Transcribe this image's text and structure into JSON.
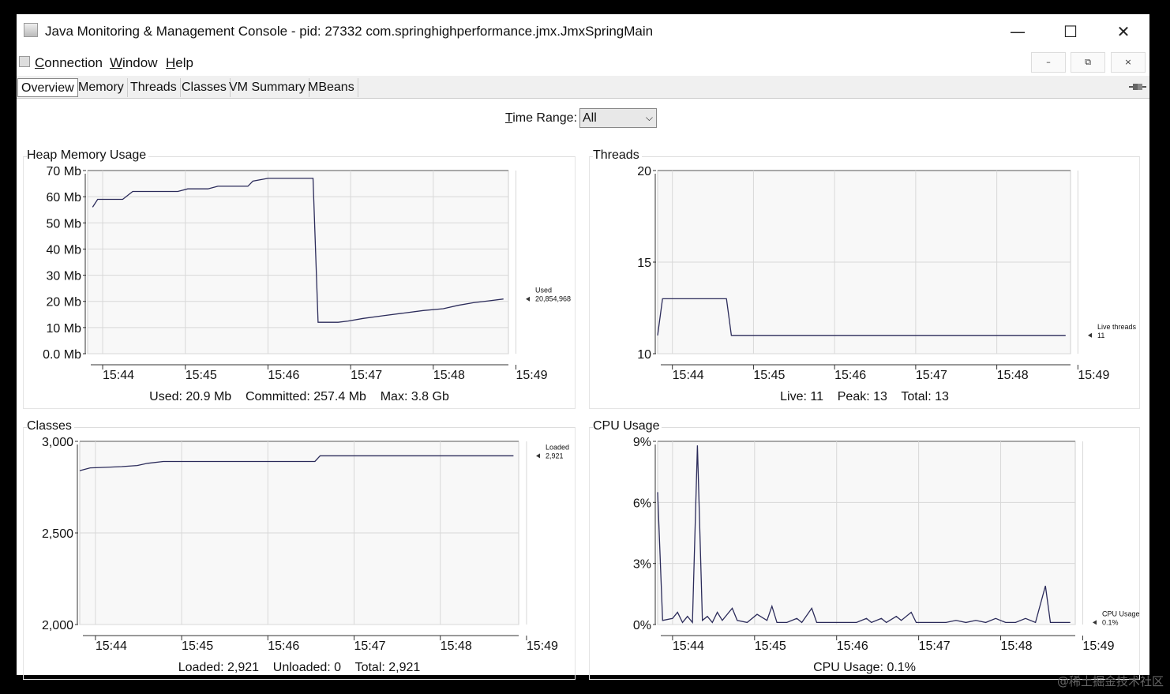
{
  "window": {
    "title": "Java Monitoring & Management Console - pid: 27332 com.springhighperformance.jmx.JmxSpringMain",
    "minimize": "—",
    "maximize": "☐",
    "close": "✕"
  },
  "menu": {
    "connection": "onnection",
    "connection_key": "C",
    "window": "indow",
    "window_key": "W",
    "help": "elp",
    "help_key": "H",
    "mdi_min": "–",
    "mdi_restore": "⧉",
    "mdi_close": "×"
  },
  "tabs": [
    "Overview",
    "Memory",
    "Threads",
    "Classes",
    "VM Summary",
    "MBeans"
  ],
  "time_range": {
    "label_key": "T",
    "label_rest": "ime Range:",
    "value": "All"
  },
  "chart_data": [
    {
      "type": "line",
      "title": "Heap Memory Usage",
      "x_ticks": [
        "15:44",
        "15:45",
        "15:46",
        "15:47",
        "15:48",
        "15:49"
      ],
      "y_ticks": [
        "0.0 Mb",
        "10 Mb",
        "20 Mb",
        "30 Mb",
        "40 Mb",
        "50 Mb",
        "60 Mb",
        "70 Mb"
      ],
      "ylim": [
        0,
        70
      ],
      "xlim": [
        15.4,
        16.24
      ],
      "series": [
        {
          "name": "Used",
          "points": [
            [
              15.41,
              56
            ],
            [
              15.42,
              59
            ],
            [
              15.47,
              59
            ],
            [
              15.49,
              62
            ],
            [
              15.58,
              62
            ],
            [
              15.6,
              63
            ],
            [
              15.64,
              63
            ],
            [
              15.66,
              64
            ],
            [
              15.72,
              64
            ],
            [
              15.73,
              66
            ],
            [
              15.76,
              67
            ],
            [
              15.85,
              67
            ],
            [
              15.86,
              12
            ],
            [
              15.9,
              12
            ],
            [
              15.92,
              12.5
            ],
            [
              15.95,
              13.5
            ],
            [
              15.99,
              14.5
            ],
            [
              16.03,
              15.5
            ],
            [
              16.07,
              16.5
            ],
            [
              16.11,
              17.2
            ],
            [
              16.14,
              18.5
            ],
            [
              16.17,
              19.5
            ],
            [
              16.2,
              20.2
            ],
            [
              16.23,
              20.9
            ]
          ],
          "last_value": "20,854,968"
        }
      ],
      "summary": "Used: 20.9 Mb    Committed: 257.4 Mb    Max: 3.8 Gb"
    },
    {
      "type": "line",
      "title": "Threads",
      "x_ticks": [
        "15:44",
        "15:45",
        "15:46",
        "15:47",
        "15:48",
        "15:49"
      ],
      "y_ticks": [
        "10",
        "15",
        "20"
      ],
      "ylim": [
        10,
        20
      ],
      "xlim": [
        15.4,
        16.24
      ],
      "series": [
        {
          "name": "Live threads",
          "points": [
            [
              15.4,
              11
            ],
            [
              15.41,
              13
            ],
            [
              15.54,
              13
            ],
            [
              15.55,
              11
            ],
            [
              16.23,
              11
            ]
          ],
          "last_value": "11"
        }
      ],
      "summary": "Live: 11    Peak: 13    Total: 13"
    },
    {
      "type": "line",
      "title": "Classes",
      "x_ticks": [
        "15:44",
        "15:45",
        "15:46",
        "15:47",
        "15:48",
        "15:49"
      ],
      "y_ticks": [
        "2,000",
        "2,500",
        "3,000"
      ],
      "ylim": [
        2000,
        3000
      ],
      "xlim": [
        15.4,
        16.24
      ],
      "series": [
        {
          "name": "Loaded",
          "points": [
            [
              15.4,
              2840
            ],
            [
              15.42,
              2855
            ],
            [
              15.45,
              2858
            ],
            [
              15.48,
              2862
            ],
            [
              15.51,
              2868
            ],
            [
              15.53,
              2880
            ],
            [
              15.56,
              2890
            ],
            [
              15.85,
              2890
            ],
            [
              15.86,
              2921
            ],
            [
              16.23,
              2921
            ]
          ],
          "last_value": "2,921"
        }
      ],
      "summary": "Loaded: 2,921    Unloaded: 0    Total: 2,921"
    },
    {
      "type": "line",
      "title": "CPU Usage",
      "x_ticks": [
        "15:44",
        "15:45",
        "15:46",
        "15:47",
        "15:48",
        "15:49"
      ],
      "y_ticks": [
        "0%",
        "3%",
        "6%",
        "9%"
      ],
      "ylim": [
        0,
        9
      ],
      "xlim": [
        15.4,
        16.24
      ],
      "series": [
        {
          "name": "CPU Usage",
          "points": [
            [
              15.4,
              6.5
            ],
            [
              15.41,
              0.2
            ],
            [
              15.43,
              0.3
            ],
            [
              15.44,
              0.6
            ],
            [
              15.45,
              0.1
            ],
            [
              15.46,
              0.4
            ],
            [
              15.47,
              0.1
            ],
            [
              15.48,
              8.8
            ],
            [
              15.49,
              0.2
            ],
            [
              15.5,
              0.4
            ],
            [
              15.51,
              0.1
            ],
            [
              15.52,
              0.6
            ],
            [
              15.53,
              0.2
            ],
            [
              15.55,
              0.8
            ],
            [
              15.56,
              0.2
            ],
            [
              15.58,
              0.1
            ],
            [
              15.6,
              0.5
            ],
            [
              15.62,
              0.2
            ],
            [
              15.63,
              0.9
            ],
            [
              15.64,
              0.1
            ],
            [
              15.66,
              0.1
            ],
            [
              15.68,
              0.3
            ],
            [
              15.69,
              0.1
            ],
            [
              15.71,
              0.8
            ],
            [
              15.72,
              0.1
            ],
            [
              15.74,
              0.1
            ],
            [
              15.76,
              0.1
            ],
            [
              15.78,
              0.1
            ],
            [
              15.8,
              0.1
            ],
            [
              15.82,
              0.3
            ],
            [
              15.83,
              0.1
            ],
            [
              15.85,
              0.3
            ],
            [
              15.86,
              0.1
            ],
            [
              15.88,
              0.4
            ],
            [
              15.89,
              0.2
            ],
            [
              15.91,
              0.6
            ],
            [
              15.92,
              0.1
            ],
            [
              15.94,
              0.1
            ],
            [
              15.96,
              0.1
            ],
            [
              15.98,
              0.1
            ],
            [
              16.0,
              0.2
            ],
            [
              16.02,
              0.1
            ],
            [
              16.04,
              0.2
            ],
            [
              16.06,
              0.1
            ],
            [
              16.08,
              0.3
            ],
            [
              16.1,
              0.1
            ],
            [
              16.12,
              0.1
            ],
            [
              16.14,
              0.3
            ],
            [
              16.16,
              0.1
            ],
            [
              16.18,
              1.9
            ],
            [
              16.19,
              0.1
            ],
            [
              16.21,
              0.1
            ],
            [
              16.23,
              0.1
            ]
          ],
          "last_value": "0.1%"
        }
      ],
      "summary": "CPU Usage: 0.1%"
    }
  ],
  "watermark": "@稀土掘金技术社区",
  "colors": {
    "series": "#2b2b5a",
    "grid": "#d8d8d8",
    "plot_bg": "#f8f8f8"
  }
}
